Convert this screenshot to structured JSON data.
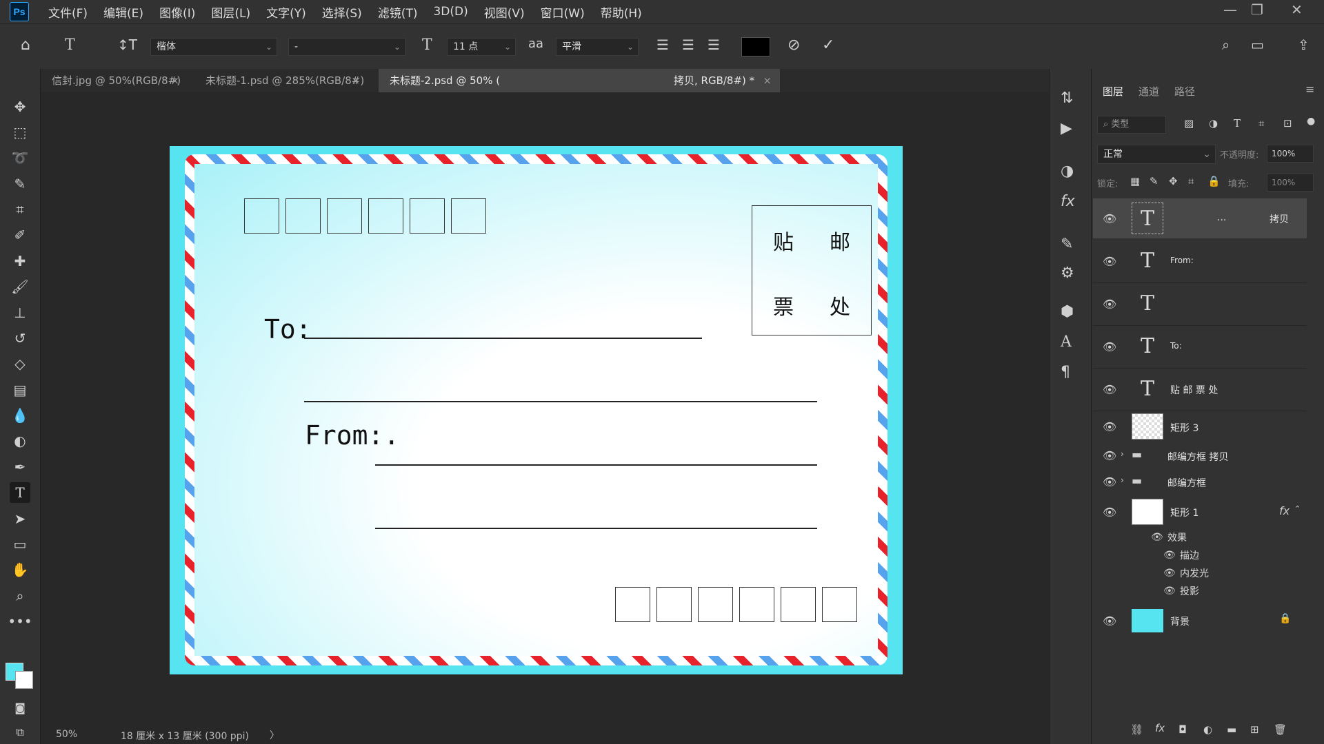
{
  "app": {
    "logo": "Ps"
  },
  "menu": [
    "文件(F)",
    "编辑(E)",
    "图像(I)",
    "图层(L)",
    "文字(Y)",
    "选择(S)",
    "滤镜(T)",
    "3D(D)",
    "视图(V)",
    "窗口(W)",
    "帮助(H)"
  ],
  "options": {
    "font_family": "楷体",
    "font_style": "-",
    "font_size": "11 点",
    "antialias_icon": "aa",
    "antialias": "平滑",
    "text_color": "#000000"
  },
  "tabs": [
    {
      "label": "信封.jpg @ 50%(RGB/8#)",
      "close": "×"
    },
    {
      "label": "未标题-1.psd @ 285%(RGB/8#)",
      "close": "×"
    },
    {
      "label": "未标题-2.psd @ 50% (",
      "label2": "拷贝, RGB/8#) *",
      "close": "×"
    }
  ],
  "envelope": {
    "to_label": "To:",
    "from_label": "From:.",
    "stamp_chars": [
      "贴",
      "邮",
      "票",
      "处"
    ],
    "background_color": "#55e4f0"
  },
  "status": {
    "zoom": "50%",
    "doc_info": "18 厘米 x 13 厘米 (300 ppi)",
    "arrow": "〉"
  },
  "panel": {
    "tabs": [
      "图层",
      "通道",
      "路径"
    ],
    "filter_kind": "类型",
    "blend_mode": "正常",
    "opacity_label": "不透明度:",
    "opacity_value": "100%",
    "lock_label": "锁定:",
    "fill_label": "填充:",
    "fill_value": "100%",
    "layers": [
      {
        "name": "拷贝",
        "dots": "...",
        "kind": "text",
        "selected": true
      },
      {
        "name": "From:",
        "kind": "text"
      },
      {
        "name": "",
        "kind": "text"
      },
      {
        "name": "To:",
        "kind": "text"
      },
      {
        "name": "贴 邮 票 处",
        "kind": "text"
      },
      {
        "name": "矩形 3",
        "kind": "shape"
      },
      {
        "name": "邮编方框 拷贝",
        "kind": "group"
      },
      {
        "name": "邮编方框",
        "kind": "group"
      },
      {
        "name": "矩形 1",
        "kind": "shape",
        "fx": "fx"
      },
      {
        "name": "背景",
        "kind": "background"
      }
    ],
    "effects_label": "效果",
    "effects": [
      "描边",
      "内发光",
      "投影"
    ]
  }
}
